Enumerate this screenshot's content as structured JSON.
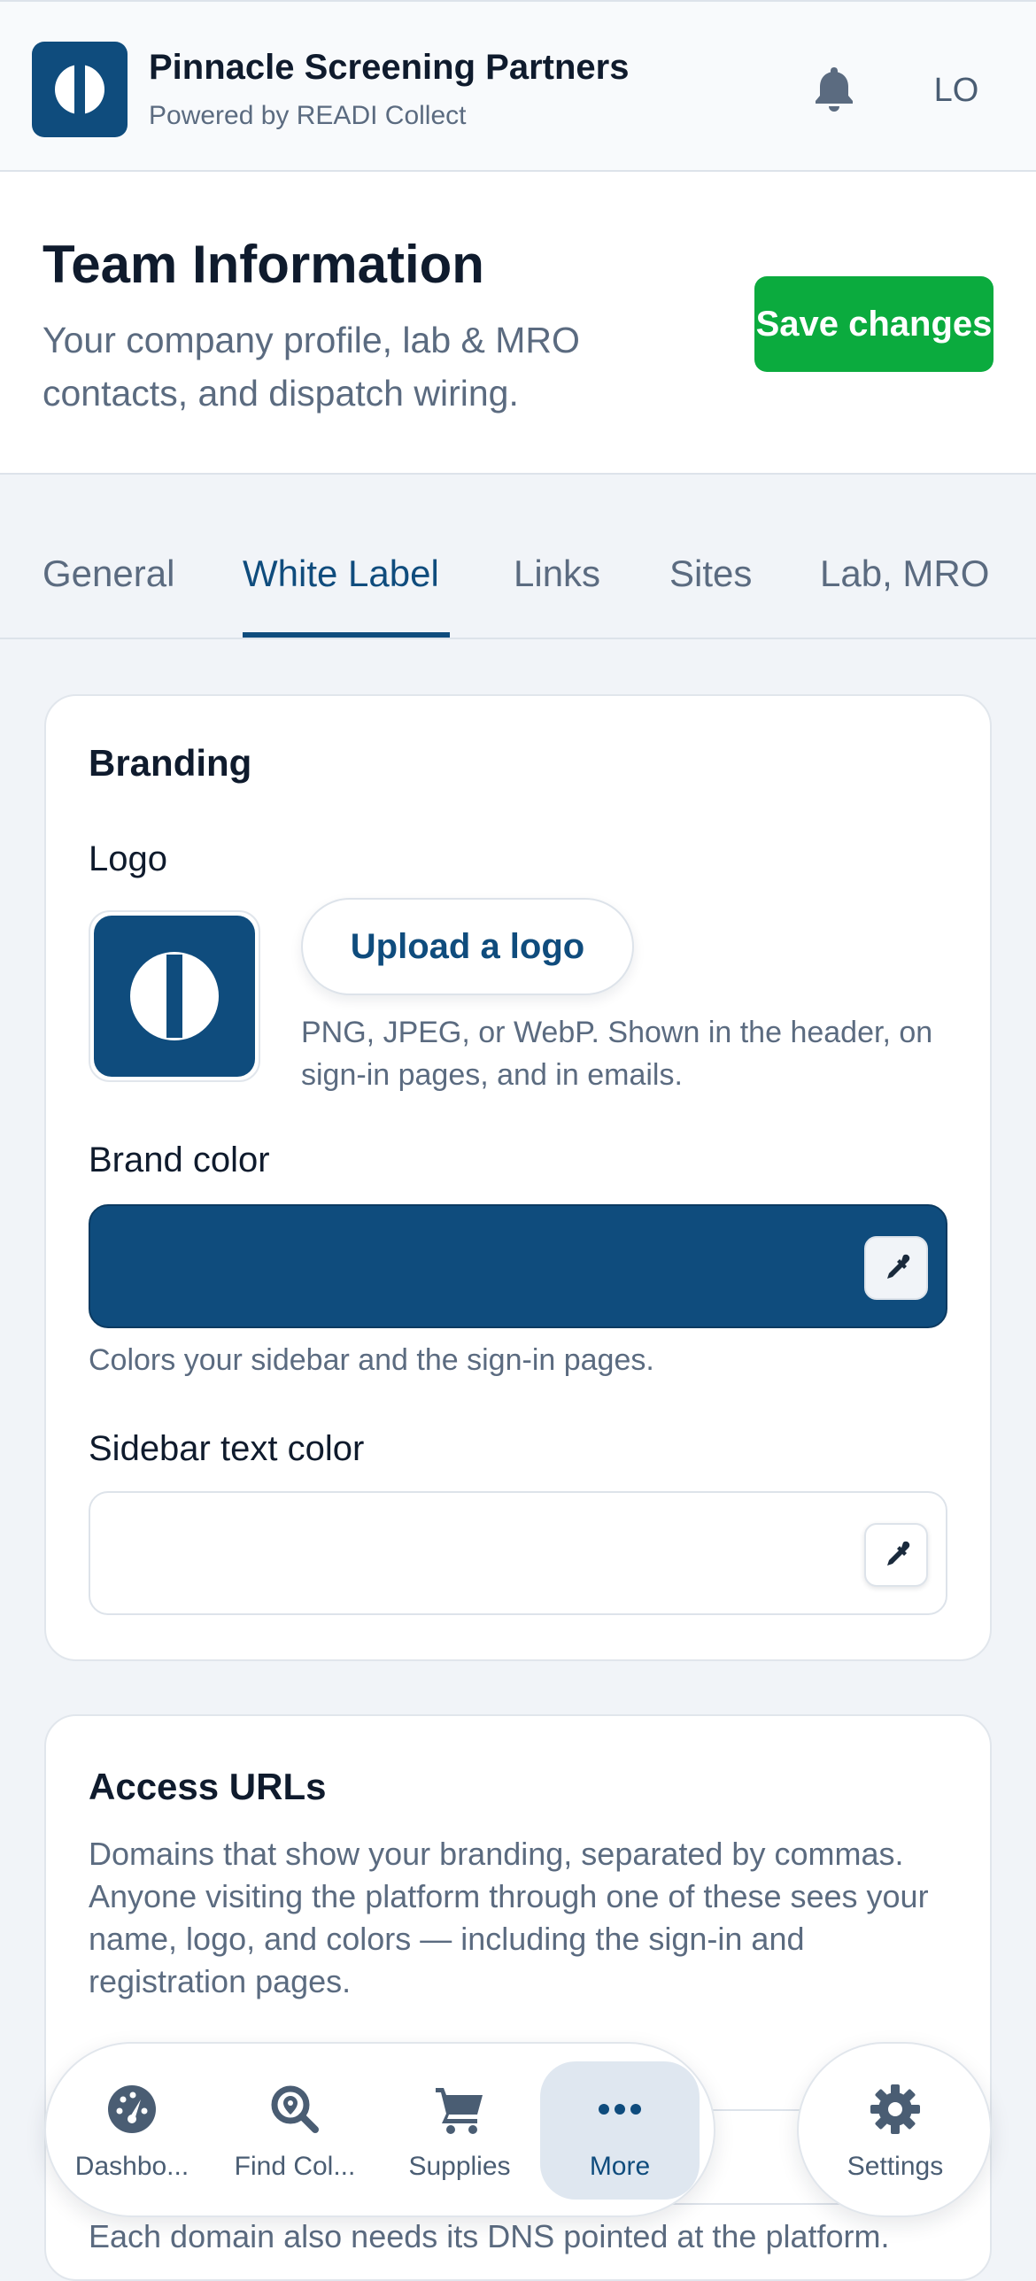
{
  "header": {
    "org_name": "Pinnacle Screening Partners",
    "powered_by": "Powered by READI Collect",
    "user_initials": "LO"
  },
  "page": {
    "title": "Team Information",
    "description": "Your company profile, lab & MRO contacts, and dispatch wiring.",
    "save_label": "Save changes"
  },
  "tabs": [
    {
      "label": "General",
      "active": false
    },
    {
      "label": "White Label",
      "active": true
    },
    {
      "label": "Links",
      "active": false
    },
    {
      "label": "Sites",
      "active": false
    },
    {
      "label": "Lab, MRO",
      "active": false
    }
  ],
  "branding": {
    "title": "Branding",
    "logo_label": "Logo",
    "upload_label": "Upload a logo",
    "logo_help": "PNG, JPEG, or WebP. Shown in the header, on sign-in pages, and in emails.",
    "brand_color_label": "Brand color",
    "brand_color_value": "#0f4c7d",
    "brand_color_help": "Colors your sidebar and the sign-in pages.",
    "sidebar_text_label": "Sidebar text color",
    "sidebar_text_value": "#ffffff"
  },
  "access_urls": {
    "title": "Access URLs",
    "description": "Domains that show your branding, separated by commas. Anyone visiting the platform through one of these sees your name, logo, and colors — including the sign-in and registration pages.",
    "footer_note": "Each domain also needs its DNS pointed at the platform."
  },
  "bottom_nav": {
    "items": [
      {
        "label": "Dashbo...",
        "icon": "gauge-icon",
        "active": false
      },
      {
        "label": "Find Col...",
        "icon": "search-pin-icon",
        "active": false
      },
      {
        "label": "Supplies",
        "icon": "cart-icon",
        "active": false
      },
      {
        "label": "More",
        "icon": "more-dots-icon",
        "active": true
      }
    ],
    "settings_label": "Settings"
  },
  "colors": {
    "brand": "#0f4c7d",
    "save_green": "#0bab3e",
    "muted_text": "#5b6b80"
  }
}
